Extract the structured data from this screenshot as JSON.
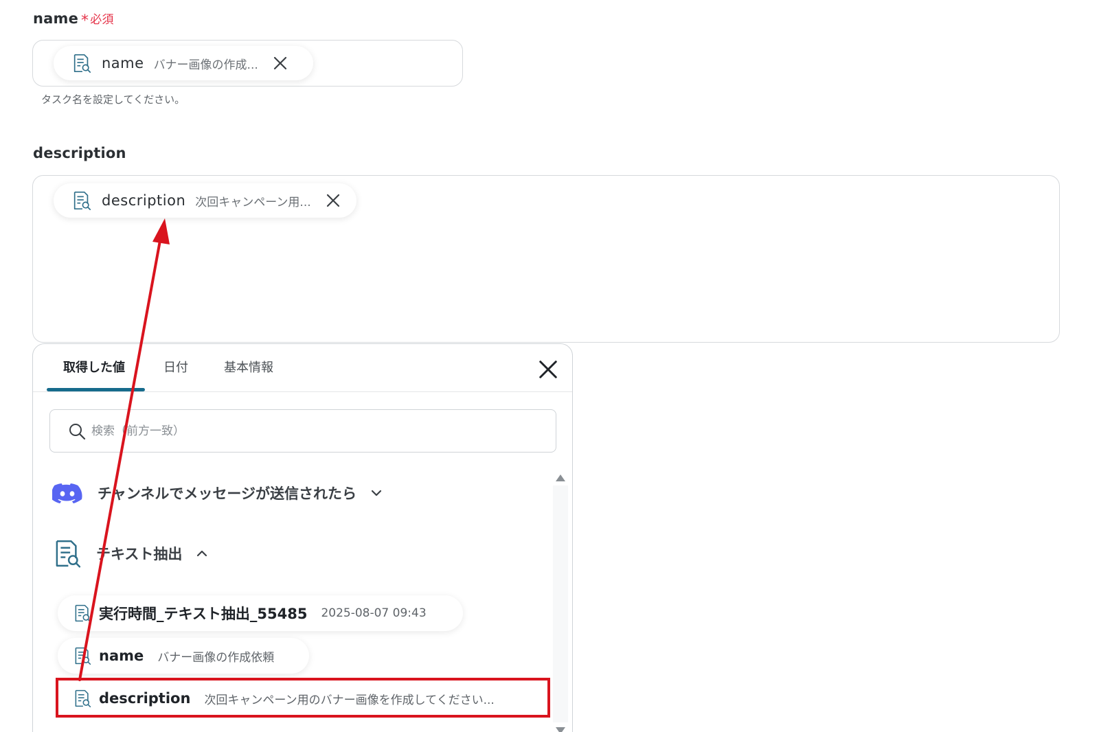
{
  "name_field": {
    "label": "name",
    "required_star": "*",
    "required_text": "必須",
    "chip": {
      "name": "name",
      "value": "バナー画像の作成..."
    },
    "helper": "タスク名を設定してください。"
  },
  "description_field": {
    "label": "description",
    "chip": {
      "name": "description",
      "value": "次回キャンペーン用..."
    }
  },
  "panel": {
    "tabs": [
      {
        "label": "取得した値"
      },
      {
        "label": "日付"
      },
      {
        "label": "基本情報"
      }
    ],
    "search_placeholder": "検索（前方一致）",
    "groups": [
      {
        "title": "チャンネルでメッセージが送信されたら",
        "icon": "discord-icon",
        "expanded": false
      },
      {
        "title": "テキスト抽出",
        "icon": "document-search-icon",
        "expanded": true
      }
    ],
    "items": [
      {
        "name": "実行時間_テキスト抽出_55485",
        "value": "2025-08-07 09:43"
      },
      {
        "name": "name",
        "value": "バナー画像の作成依頼"
      },
      {
        "name": "description",
        "value": "次回キャンペーン用のバナー画像を作成してください..."
      }
    ]
  },
  "colors": {
    "accent": "#166b8c",
    "required": "#e5344a",
    "annotation": "#d9141e",
    "discord": "#5865f2"
  }
}
